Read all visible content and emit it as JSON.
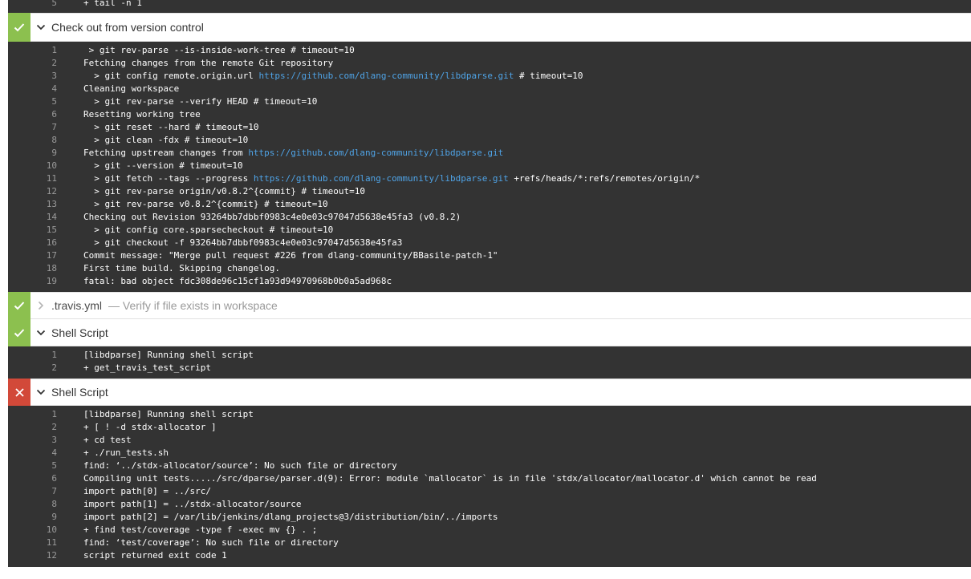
{
  "log0": [
    {
      "n": "5",
      "t": "+ tail -n 1"
    }
  ],
  "steps": [
    {
      "status": "success",
      "title": "Check out from version control",
      "desc": "",
      "expanded": true
    },
    {
      "status": "success",
      "title": ".travis.yml",
      "desc": "— Verify if file exists in workspace",
      "expanded": false
    },
    {
      "status": "success",
      "title": "Shell Script",
      "desc": "",
      "expanded": true
    },
    {
      "status": "failure",
      "title": "Shell Script",
      "desc": "",
      "expanded": true
    }
  ],
  "log1": [
    {
      "n": "1",
      "parts": [
        {
          "t": " > git rev-parse --is-inside-work-tree # timeout=10"
        }
      ]
    },
    {
      "n": "2",
      "parts": [
        {
          "t": "Fetching changes from the remote Git repository"
        }
      ]
    },
    {
      "n": "3",
      "parts": [
        {
          "t": "  > git config remote.origin.url "
        },
        {
          "t": "https://github.com/dlang-community/libdparse.git",
          "link": true
        },
        {
          "t": " # timeout=10"
        }
      ]
    },
    {
      "n": "4",
      "parts": [
        {
          "t": "Cleaning workspace"
        }
      ]
    },
    {
      "n": "5",
      "parts": [
        {
          "t": "  > git rev-parse --verify HEAD # timeout=10"
        }
      ]
    },
    {
      "n": "6",
      "parts": [
        {
          "t": "Resetting working tree"
        }
      ]
    },
    {
      "n": "7",
      "parts": [
        {
          "t": "  > git reset --hard # timeout=10"
        }
      ]
    },
    {
      "n": "8",
      "parts": [
        {
          "t": "  > git clean -fdx # timeout=10"
        }
      ]
    },
    {
      "n": "9",
      "parts": [
        {
          "t": "Fetching upstream changes from "
        },
        {
          "t": "https://github.com/dlang-community/libdparse.git",
          "link": true
        }
      ]
    },
    {
      "n": "10",
      "parts": [
        {
          "t": "  > git --version # timeout=10"
        }
      ]
    },
    {
      "n": "11",
      "parts": [
        {
          "t": "  > git fetch --tags --progress "
        },
        {
          "t": "https://github.com/dlang-community/libdparse.git",
          "link": true
        },
        {
          "t": " +refs/heads/*:refs/remotes/origin/*"
        }
      ]
    },
    {
      "n": "12",
      "parts": [
        {
          "t": "  > git rev-parse origin/v0.8.2^{commit} # timeout=10"
        }
      ]
    },
    {
      "n": "13",
      "parts": [
        {
          "t": "  > git rev-parse v0.8.2^{commit} # timeout=10"
        }
      ]
    },
    {
      "n": "14",
      "parts": [
        {
          "t": "Checking out Revision 93264bb7dbbf0983c4e0e03c97047d5638e45fa3 (v0.8.2)"
        }
      ]
    },
    {
      "n": "15",
      "parts": [
        {
          "t": "  > git config core.sparsecheckout # timeout=10"
        }
      ]
    },
    {
      "n": "16",
      "parts": [
        {
          "t": "  > git checkout -f 93264bb7dbbf0983c4e0e03c97047d5638e45fa3"
        }
      ]
    },
    {
      "n": "17",
      "parts": [
        {
          "t": "Commit message: \"Merge pull request #226 from dlang-community/BBasile-patch-1\""
        }
      ]
    },
    {
      "n": "18",
      "parts": [
        {
          "t": "First time build. Skipping changelog."
        }
      ]
    },
    {
      "n": "19",
      "parts": [
        {
          "t": "fatal: bad object fdc308de96c15cf1a93d94970968b0b0a5ad968c"
        }
      ]
    }
  ],
  "log3": [
    {
      "n": "1",
      "t": "[libdparse] Running shell script"
    },
    {
      "n": "2",
      "t": "+ get_travis_test_script"
    }
  ],
  "log4": [
    {
      "n": "1",
      "t": "[libdparse] Running shell script"
    },
    {
      "n": "2",
      "t": "+ [ ! -d stdx-allocator ]"
    },
    {
      "n": "3",
      "t": "+ cd test"
    },
    {
      "n": "4",
      "t": "+ ./run_tests.sh"
    },
    {
      "n": "5",
      "t": "find: ‘../stdx-allocator/source’: No such file or directory"
    },
    {
      "n": "6",
      "t": "Compiling unit tests...../src/dparse/parser.d(9): Error: module `mallocator` is in file 'stdx/allocator/mallocator.d' which cannot be read"
    },
    {
      "n": "7",
      "t": "import path[0] = ../src/"
    },
    {
      "n": "8",
      "t": "import path[1] = ../stdx-allocator/source"
    },
    {
      "n": "9",
      "t": "import path[2] = /var/lib/jenkins/dlang_projects@3/distribution/bin/../imports"
    },
    {
      "n": "10",
      "t": "+ find test/coverage -type f -exec mv {} . ;"
    },
    {
      "n": "11",
      "t": "find: ‘test/coverage’: No such file or directory"
    },
    {
      "n": "12",
      "t": "script returned exit code 1"
    }
  ],
  "icons": {
    "success": "check-icon",
    "failure": "cross-icon",
    "expanded": "chevron-down-icon",
    "collapsed": "chevron-right-icon"
  },
  "colors": {
    "success": "#8cc04f",
    "failure": "#d24939",
    "log_bg": "#333333",
    "link": "#4fa3e6"
  }
}
